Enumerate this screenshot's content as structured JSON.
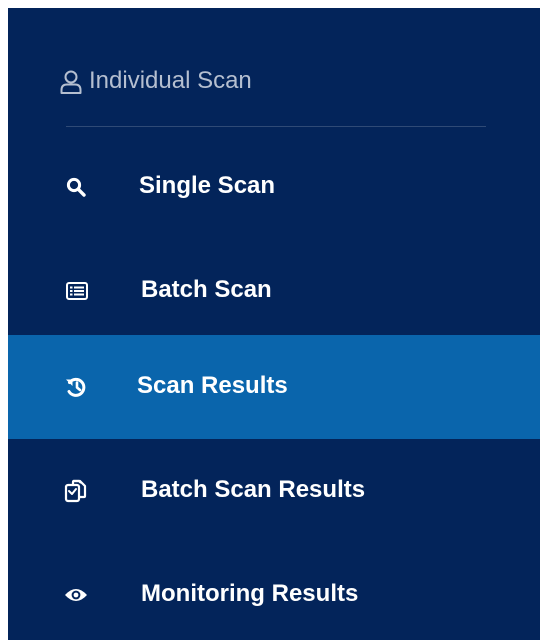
{
  "sidebar": {
    "section_header": {
      "label": "Individual Scan",
      "icon": "user-icon"
    },
    "items": [
      {
        "label": "Single Scan",
        "icon": "search-icon",
        "active": false
      },
      {
        "label": "Batch Scan",
        "icon": "list-icon",
        "active": false
      },
      {
        "label": "Scan Results",
        "icon": "history-icon",
        "active": true
      },
      {
        "label": "Batch Scan Results",
        "icon": "copy-icon",
        "active": false
      },
      {
        "label": "Monitoring Results",
        "icon": "eye-icon",
        "active": false
      }
    ]
  },
  "colors": {
    "sidebar_bg": "#03245a",
    "active_bg": "#0a65ac",
    "header_text": "#b5bfd0",
    "item_text": "#ffffff"
  }
}
